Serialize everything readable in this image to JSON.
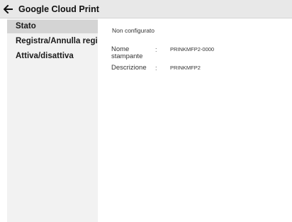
{
  "header": {
    "back_icon": "left-arrow-icon",
    "title": "Google Cloud Print"
  },
  "sidebar": {
    "items": [
      {
        "label": "Stato",
        "active": true
      },
      {
        "label": "Registra/Annulla registraz",
        "active": false
      },
      {
        "label": "Attiva/disattiva",
        "active": false
      }
    ]
  },
  "main": {
    "status": "Non configurato",
    "fields": [
      {
        "label": "Nome stampante",
        "separator": ":",
        "value": "PRINKMFP2-0000"
      },
      {
        "label": "Descrizione",
        "separator": ":",
        "value": "PRINKMFP2"
      }
    ]
  }
}
